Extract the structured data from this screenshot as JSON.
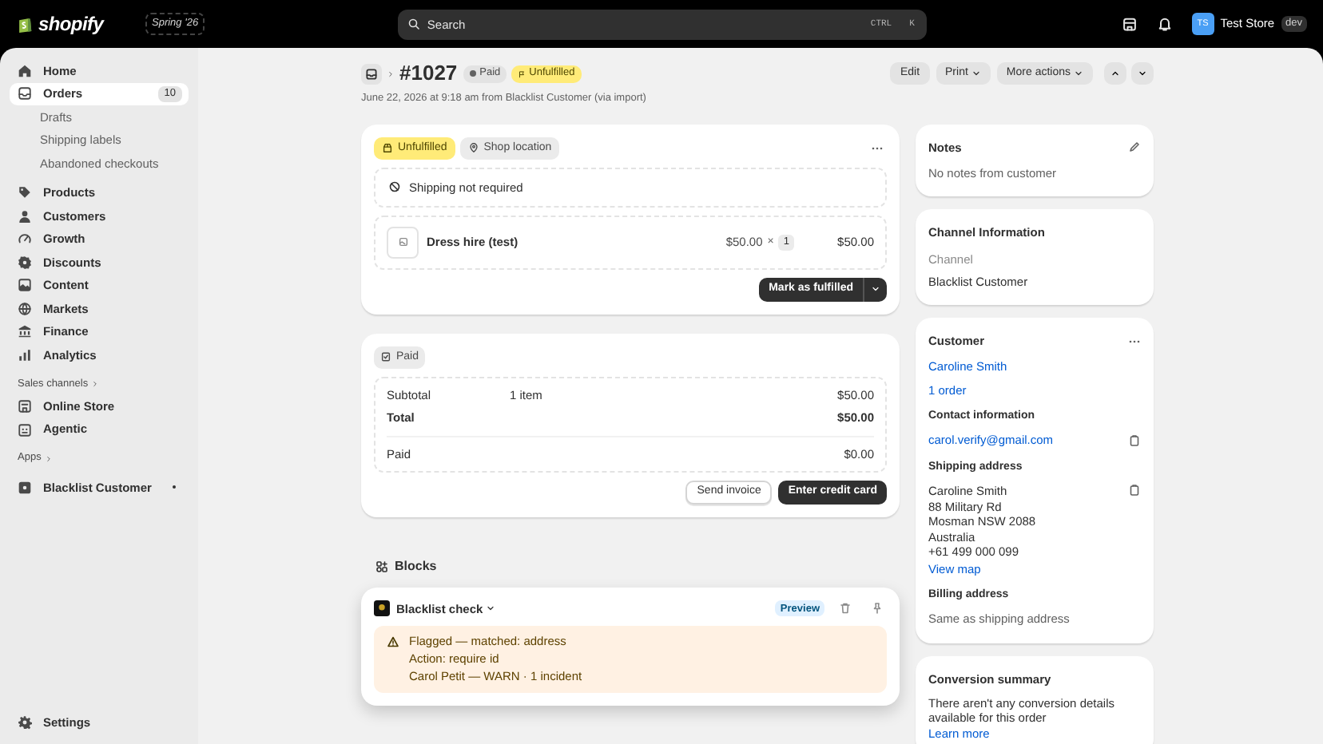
{
  "top_bar": {
    "logo": "shopify",
    "edition": "Spring '26",
    "search": {
      "placeholder": "Search",
      "shortcut": [
        "CTRL",
        "K"
      ]
    },
    "store": {
      "initials": "TS",
      "name": "Test Store",
      "badge": "dev"
    }
  },
  "sidebar": {
    "items": [
      {
        "label": "Home",
        "selected": false
      },
      {
        "label": "Orders",
        "selected": true,
        "badge": "10",
        "children": [
          {
            "label": "Drafts",
            "selected": false
          },
          {
            "label": "Shipping labels",
            "selected": false
          },
          {
            "label": "Abandoned checkouts",
            "selected": false
          }
        ]
      },
      {
        "label": "Products",
        "selected": false
      },
      {
        "label": "Customers",
        "selected": false
      },
      {
        "label": "Growth",
        "selected": false
      },
      {
        "label": "Discounts",
        "selected": false
      },
      {
        "label": "Content",
        "selected": false
      },
      {
        "label": "Markets",
        "selected": false
      },
      {
        "label": "Finance",
        "selected": false
      },
      {
        "label": "Analytics",
        "selected": false
      }
    ],
    "sections": [
      {
        "title": "Sales channels",
        "items": [
          {
            "label": "Online Store",
            "selected": false
          },
          {
            "label": "Agentic",
            "selected": false
          }
        ]
      },
      {
        "title": "Apps",
        "items": [
          {
            "label": "Blacklist Customer",
            "selected": false
          }
        ]
      }
    ],
    "footer": {
      "label": "Settings",
      "selected": false
    }
  },
  "header": {
    "order_number": "#1027",
    "badges": [
      {
        "label": "Paid",
        "kind": "payment"
      },
      {
        "label": "Unfulfilled",
        "kind": "fulfillment"
      }
    ],
    "subtitle": "June 22, 2026 at 9:18 am from Blacklist Customer (via import)",
    "actions": [
      {
        "label": "Edit",
        "dropdown": false
      },
      {
        "label": "Print",
        "dropdown": true
      },
      {
        "label": "More actions",
        "dropdown": true
      }
    ]
  },
  "fulfillment": {
    "status": "Unfulfilled",
    "location": "Shop location",
    "shipping_note": "Shipping not required",
    "line_items": [
      {
        "name": "Dress hire (test)",
        "price": "$50.00",
        "times": "×",
        "quantity": "1",
        "total": "$50.00"
      }
    ],
    "primary_action": "Mark as fulfilled"
  },
  "payment": {
    "status": "Paid",
    "rows": [
      {
        "label": "Subtotal",
        "detail": "1 item",
        "amount": "$50.00",
        "bold": false
      },
      {
        "label": "Total",
        "amount": "$50.00",
        "bold": true
      }
    ],
    "paid": {
      "label": "Paid",
      "amount": "$0.00"
    },
    "actions": [
      {
        "label": "Send invoice",
        "kind": "secondary"
      },
      {
        "label": "Enter credit card",
        "kind": "primary"
      }
    ]
  },
  "blocks": {
    "title": "Blocks",
    "card": {
      "title": "Blacklist check",
      "badge": "Preview",
      "alert": [
        "Flagged — matched: address",
        "Action: require id",
        "Carol Petit — WARN · 1 incident"
      ]
    }
  },
  "notes": {
    "title": "Notes",
    "body": "No notes from customer"
  },
  "channel": {
    "title": "Channel Information",
    "label": "Channel",
    "value": "Blacklist Customer"
  },
  "customer": {
    "title": "Customer",
    "name": "Caroline Smith",
    "orders": "1 order",
    "contact_title": "Contact information",
    "email": "carol.verify@gmail.com",
    "shipping_title": "Shipping address",
    "address": [
      "Caroline Smith",
      "88 Military Rd",
      "Mosman NSW 2088",
      "Australia",
      "+61 499 000 099"
    ],
    "map_link": "View map",
    "billing_title": "Billing address",
    "billing": "Same as shipping address"
  },
  "conversion": {
    "title": "Conversion summary",
    "body": "There aren't any conversion details available for this order",
    "link": "Learn more"
  }
}
